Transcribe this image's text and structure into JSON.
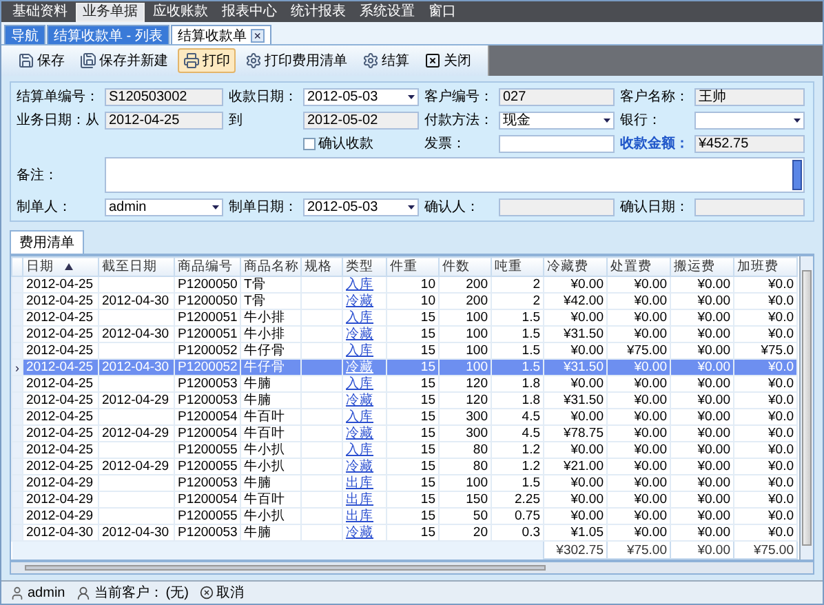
{
  "menu": [
    {
      "label": "基础资料",
      "selected": false
    },
    {
      "label": "业务单据",
      "selected": true
    },
    {
      "label": "应收账款",
      "selected": false
    },
    {
      "label": "报表中心",
      "selected": false
    },
    {
      "label": "统计报表",
      "selected": false
    },
    {
      "label": "系统设置",
      "selected": false
    },
    {
      "label": "窗口",
      "selected": false
    }
  ],
  "tabs": [
    {
      "label": "导航",
      "selected": false,
      "closable": false
    },
    {
      "label": "结算收款单 - 列表",
      "selected": false,
      "closable": false
    },
    {
      "label": "结算收款单",
      "selected": true,
      "closable": true
    }
  ],
  "close_tab": "×",
  "toolbar": [
    {
      "label": "保存",
      "selected": false
    },
    {
      "label": "保存并新建",
      "selected": false
    },
    {
      "label": "打印",
      "selected": true
    },
    {
      "label": "打印费用清单",
      "selected": false
    },
    {
      "label": "结算",
      "selected": false
    },
    {
      "label": "关闭",
      "selected": false
    }
  ],
  "form": {
    "rows": [
      [
        {
          "kind": "readonly",
          "label": "结算单编号：",
          "value": "S120503002"
        },
        {
          "kind": "select",
          "label": "收款日期：",
          "value": "2012-05-03"
        },
        {
          "kind": "readonly",
          "label": "客户编号：",
          "value": "027"
        },
        {
          "kind": "readonly",
          "label": "客户名称：",
          "value": "王帅"
        }
      ],
      [
        {
          "kind": "readonly",
          "label": "业务日期：从",
          "value": "2012-04-25"
        },
        {
          "kind": "readonly",
          "label": "到",
          "value": "2012-05-02"
        },
        {
          "kind": "select",
          "label": "付款方法：",
          "value": "现金"
        },
        {
          "kind": "select",
          "label": "银行："
        }
      ],
      [
        {
          "kind": "spacer"
        },
        {
          "kind": "checkbox",
          "label": "确认收款",
          "checked": false
        },
        {
          "kind": "input",
          "label": "发票："
        },
        {
          "kind": "readonly",
          "label": "收款金额：",
          "value": "¥452.75",
          "highlight": true
        }
      ],
      [
        {
          "kind": "textarea",
          "label": "备注："
        }
      ],
      [
        {
          "kind": "select",
          "label": "制单人：",
          "value": "admin"
        },
        {
          "kind": "select",
          "label": "制单日期：",
          "value": "2012-05-03"
        },
        {
          "kind": "readonly",
          "label": "确认人："
        },
        {
          "kind": "readonly",
          "label": "确认日期："
        }
      ]
    ]
  },
  "grid_tab": {
    "label": "费用清单",
    "selected": true
  },
  "table": {
    "columns": [
      {
        "label": "日期",
        "sorted_ascending": true,
        "kind": "text"
      },
      {
        "label": "截至日期",
        "sorted_ascending": false,
        "kind": "text"
      },
      {
        "label": "商品编号",
        "sorted_ascending": false,
        "kind": "text"
      },
      {
        "label": "商品名称",
        "sorted_ascending": false,
        "kind": "text"
      },
      {
        "label": "规格",
        "sorted_ascending": false,
        "kind": "text"
      },
      {
        "label": "类型",
        "sorted_ascending": false,
        "kind": "link"
      },
      {
        "label": "件重",
        "sorted_ascending": false,
        "kind": "number"
      },
      {
        "label": "件数",
        "sorted_ascending": false,
        "kind": "number"
      },
      {
        "label": "吨重",
        "sorted_ascending": false,
        "kind": "number"
      },
      {
        "label": "冷藏费",
        "sorted_ascending": false,
        "kind": "number"
      },
      {
        "label": "处置费",
        "sorted_ascending": false,
        "kind": "number"
      },
      {
        "label": "搬运费",
        "sorted_ascending": false,
        "kind": "number"
      },
      {
        "label": "加班费",
        "sorted_ascending": false,
        "kind": "number"
      }
    ],
    "current_marker": "›",
    "rows": [
      {
        "selected": false,
        "cells": [
          "2012-04-25",
          "",
          "P1200050",
          "T骨",
          "",
          "入库",
          "10",
          "200",
          "2",
          "¥0.00",
          "¥0.00",
          "¥0.00",
          "¥0.0"
        ]
      },
      {
        "selected": false,
        "cells": [
          "2012-04-25",
          "2012-04-30",
          "P1200050",
          "T骨",
          "",
          "冷藏",
          "10",
          "200",
          "2",
          "¥42.00",
          "¥0.00",
          "¥0.00",
          "¥0.0"
        ]
      },
      {
        "selected": false,
        "cells": [
          "2012-04-25",
          "",
          "P1200051",
          "牛小排",
          "",
          "入库",
          "15",
          "100",
          "1.5",
          "¥0.00",
          "¥0.00",
          "¥0.00",
          "¥0.0"
        ]
      },
      {
        "selected": false,
        "cells": [
          "2012-04-25",
          "2012-04-30",
          "P1200051",
          "牛小排",
          "",
          "冷藏",
          "15",
          "100",
          "1.5",
          "¥31.50",
          "¥0.00",
          "¥0.00",
          "¥0.0"
        ]
      },
      {
        "selected": false,
        "cells": [
          "2012-04-25",
          "",
          "P1200052",
          "牛仔骨",
          "",
          "入库",
          "15",
          "100",
          "1.5",
          "¥0.00",
          "¥75.00",
          "¥0.00",
          "¥75.0"
        ]
      },
      {
        "selected": true,
        "cells": [
          "2012-04-25",
          "2012-04-30",
          "P1200052",
          "牛仔骨",
          "",
          "冷藏",
          "15",
          "100",
          "1.5",
          "¥31.50",
          "¥0.00",
          "¥0.00",
          "¥0.0"
        ]
      },
      {
        "selected": false,
        "cells": [
          "2012-04-25",
          "",
          "P1200053",
          "牛腩",
          "",
          "入库",
          "15",
          "120",
          "1.8",
          "¥0.00",
          "¥0.00",
          "¥0.00",
          "¥0.0"
        ]
      },
      {
        "selected": false,
        "cells": [
          "2012-04-25",
          "2012-04-29",
          "P1200053",
          "牛腩",
          "",
          "冷藏",
          "15",
          "120",
          "1.8",
          "¥31.50",
          "¥0.00",
          "¥0.00",
          "¥0.0"
        ]
      },
      {
        "selected": false,
        "cells": [
          "2012-04-25",
          "",
          "P1200054",
          "牛百叶",
          "",
          "入库",
          "15",
          "300",
          "4.5",
          "¥0.00",
          "¥0.00",
          "¥0.00",
          "¥0.0"
        ]
      },
      {
        "selected": false,
        "cells": [
          "2012-04-25",
          "2012-04-29",
          "P1200054",
          "牛百叶",
          "",
          "冷藏",
          "15",
          "300",
          "4.5",
          "¥78.75",
          "¥0.00",
          "¥0.00",
          "¥0.0"
        ]
      },
      {
        "selected": false,
        "cells": [
          "2012-04-25",
          "",
          "P1200055",
          "牛小扒",
          "",
          "入库",
          "15",
          "80",
          "1.2",
          "¥0.00",
          "¥0.00",
          "¥0.00",
          "¥0.0"
        ]
      },
      {
        "selected": false,
        "cells": [
          "2012-04-25",
          "2012-04-29",
          "P1200055",
          "牛小扒",
          "",
          "冷藏",
          "15",
          "80",
          "1.2",
          "¥21.00",
          "¥0.00",
          "¥0.00",
          "¥0.0"
        ]
      },
      {
        "selected": false,
        "cells": [
          "2012-04-29",
          "",
          "P1200053",
          "牛腩",
          "",
          "出库",
          "15",
          "100",
          "1.5",
          "¥0.00",
          "¥0.00",
          "¥0.00",
          "¥0.0"
        ]
      },
      {
        "selected": false,
        "cells": [
          "2012-04-29",
          "",
          "P1200054",
          "牛百叶",
          "",
          "出库",
          "15",
          "150",
          "2.25",
          "¥0.00",
          "¥0.00",
          "¥0.00",
          "¥0.0"
        ]
      },
      {
        "selected": false,
        "cells": [
          "2012-04-29",
          "",
          "P1200055",
          "牛小扒",
          "",
          "出库",
          "15",
          "50",
          "0.75",
          "¥0.00",
          "¥0.00",
          "¥0.00",
          "¥0.0"
        ]
      },
      {
        "selected": false,
        "cells": [
          "2012-04-30",
          "2012-04-30",
          "P1200053",
          "牛腩",
          "",
          "冷藏",
          "15",
          "20",
          "0.3",
          "¥1.05",
          "¥0.00",
          "¥0.00",
          "¥0.0"
        ]
      }
    ],
    "totals": [
      "¥302.75",
      "¥75.00",
      "¥0.00",
      "¥75.00"
    ]
  },
  "status_bar": {
    "user": "admin",
    "customer_label": "当前客户：",
    "customer": "(无)",
    "cancel": "取消"
  }
}
